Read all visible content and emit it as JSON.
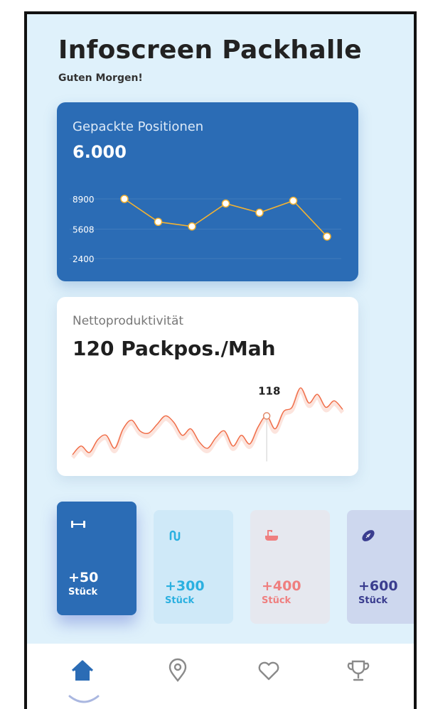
{
  "header": {
    "title": "Infoscreen Packhalle",
    "greeting": "Guten Morgen!"
  },
  "positions_card": {
    "label": "Gepackte Positionen",
    "value": "6.000"
  },
  "productivity_card": {
    "label": "Nettoproduktivität",
    "value": "120 Packpos./Mah",
    "marker_label": "118"
  },
  "tiles": [
    {
      "icon": "dumbbell-icon",
      "value": "+50",
      "unit": "Stück",
      "color": "#2b6cb5"
    },
    {
      "icon": "jump-rope-icon",
      "value": "+300",
      "unit": "Stück",
      "color": "#2bb0e0"
    },
    {
      "icon": "bathtub-icon",
      "value": "+400",
      "unit": "Stück",
      "color": "#ef7f7f"
    },
    {
      "icon": "football-icon",
      "value": "+600",
      "unit": "Stück",
      "color": "#3a3d8f"
    }
  ],
  "nav": {
    "items": [
      "home-icon",
      "location-pin-icon",
      "heart-icon",
      "trophy-icon"
    ],
    "active": "home-icon",
    "active_color": "#2b6cb5"
  },
  "chart_data": [
    {
      "type": "line",
      "x": [
        1,
        2,
        3,
        4,
        5,
        6,
        7
      ],
      "series": [
        {
          "values": [
            8900,
            6400,
            5900,
            8400,
            7400,
            8700,
            4800
          ]
        }
      ],
      "yticks": [
        "8900",
        "5608",
        "2400"
      ],
      "ylim": [
        2400,
        8900
      ],
      "grid": true,
      "line_color": "#f2b232"
    },
    {
      "type": "line",
      "series": [
        {
          "values": [
            100,
            104,
            101,
            107,
            109,
            103,
            112,
            116,
            111,
            110,
            114,
            118,
            115,
            109,
            112,
            106,
            103,
            108,
            111,
            104,
            109,
            105,
            113,
            118,
            112,
            120,
            122,
            131,
            124,
            128,
            122,
            125,
            121
          ]
        }
      ],
      "marker": {
        "index": 23,
        "value": 118
      },
      "grid": false,
      "line_color": "#f06a44"
    }
  ]
}
